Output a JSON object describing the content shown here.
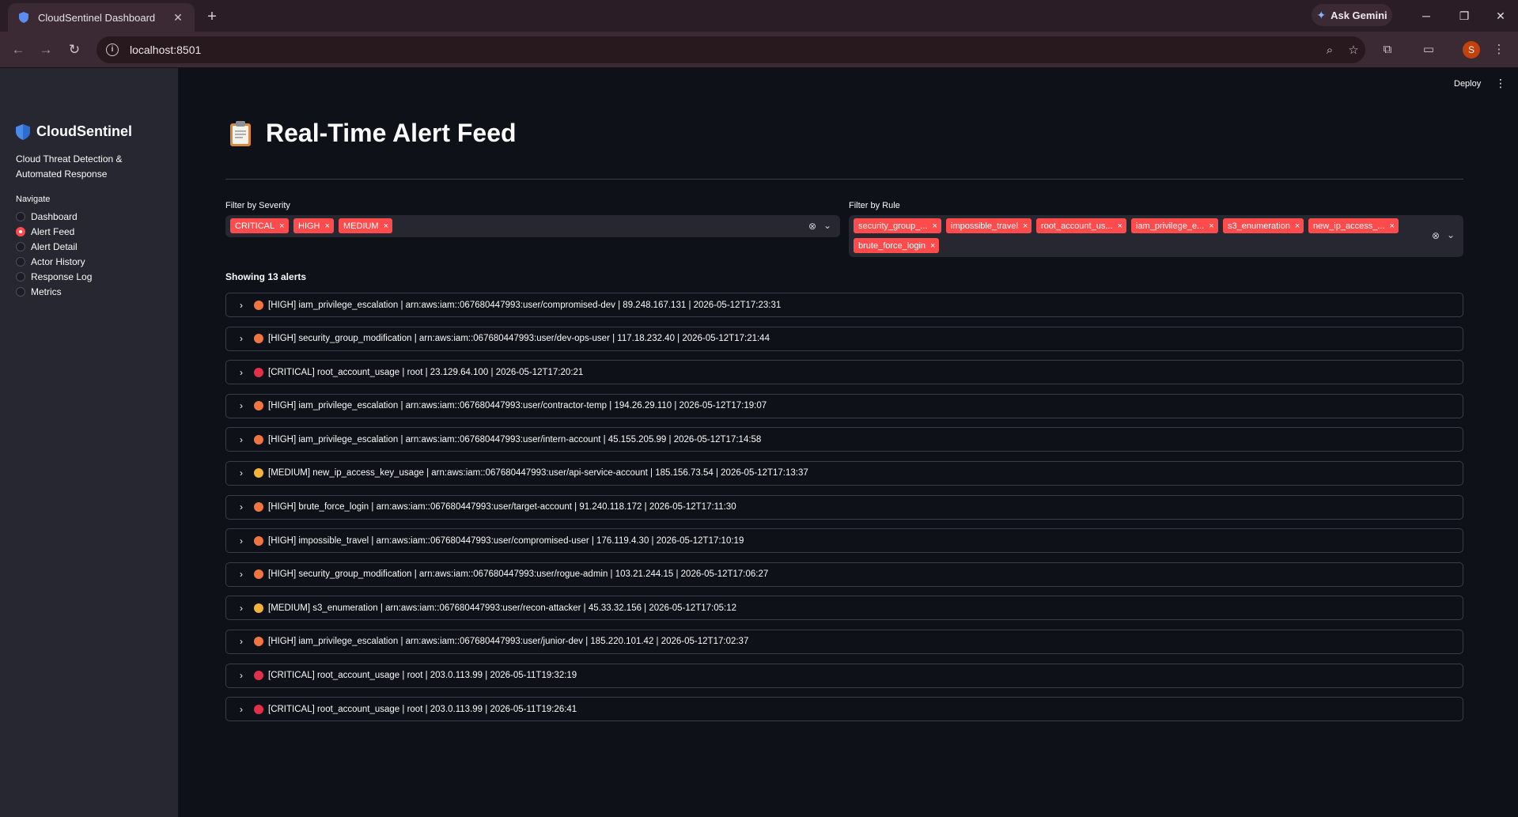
{
  "browser": {
    "tab_title": "CloudSentinel Dashboard",
    "tab_close": "✕",
    "new_tab": "+",
    "gemini_label": "Ask Gemini",
    "url": "localhost:8501",
    "profile_initial": "S"
  },
  "sidebar": {
    "brand": "CloudSentinel",
    "subtitle": "Cloud Threat Detection & Automated Response",
    "nav_label": "Navigate",
    "items": [
      {
        "label": "Dashboard",
        "selected": false
      },
      {
        "label": "Alert Feed",
        "selected": true
      },
      {
        "label": "Alert Detail",
        "selected": false
      },
      {
        "label": "Actor History",
        "selected": false
      },
      {
        "label": "Response Log",
        "selected": false
      },
      {
        "label": "Metrics",
        "selected": false
      }
    ]
  },
  "header": {
    "deploy": "Deploy",
    "menu_icon": "⋮"
  },
  "page": {
    "title": "Real-Time Alert Feed"
  },
  "filters": {
    "severity_label": "Filter by Severity",
    "severity_chips": [
      "CRITICAL",
      "HIGH",
      "MEDIUM"
    ],
    "rule_label": "Filter by Rule",
    "rule_chips": [
      "security_group_...",
      "impossible_travel",
      "root_account_us...",
      "iam_privilege_e...",
      "s3_enumeration",
      "new_ip_access_...",
      "brute_force_login"
    ],
    "chip_remove": "×"
  },
  "alert_count": "Showing 13 alerts",
  "colors": {
    "HIGH": "#f0753f",
    "CRITICAL": "#e2304a",
    "MEDIUM": "#f4b43a",
    "accent": "#ff4b4b"
  },
  "alerts": [
    {
      "severity": "HIGH",
      "text": "[HIGH] iam_privilege_escalation | arn:aws:iam::067680447993:user/compromised-dev | 89.248.167.131 | 2026-05-12T17:23:31"
    },
    {
      "severity": "HIGH",
      "text": "[HIGH] security_group_modification | arn:aws:iam::067680447993:user/dev-ops-user | 117.18.232.40 | 2026-05-12T17:21:44"
    },
    {
      "severity": "CRITICAL",
      "text": "[CRITICAL] root_account_usage | root | 23.129.64.100 | 2026-05-12T17:20:21"
    },
    {
      "severity": "HIGH",
      "text": "[HIGH] iam_privilege_escalation | arn:aws:iam::067680447993:user/contractor-temp | 194.26.29.110 | 2026-05-12T17:19:07"
    },
    {
      "severity": "HIGH",
      "text": "[HIGH] iam_privilege_escalation | arn:aws:iam::067680447993:user/intern-account | 45.155.205.99 | 2026-05-12T17:14:58"
    },
    {
      "severity": "MEDIUM",
      "text": "[MEDIUM] new_ip_access_key_usage | arn:aws:iam::067680447993:user/api-service-account | 185.156.73.54 | 2026-05-12T17:13:37"
    },
    {
      "severity": "HIGH",
      "text": "[HIGH] brute_force_login | arn:aws:iam::067680447993:user/target-account | 91.240.118.172 | 2026-05-12T17:11:30"
    },
    {
      "severity": "HIGH",
      "text": "[HIGH] impossible_travel | arn:aws:iam::067680447993:user/compromised-user | 176.119.4.30 | 2026-05-12T17:10:19"
    },
    {
      "severity": "HIGH",
      "text": "[HIGH] security_group_modification | arn:aws:iam::067680447993:user/rogue-admin | 103.21.244.15 | 2026-05-12T17:06:27"
    },
    {
      "severity": "MEDIUM",
      "text": "[MEDIUM] s3_enumeration | arn:aws:iam::067680447993:user/recon-attacker | 45.33.32.156 | 2026-05-12T17:05:12"
    },
    {
      "severity": "HIGH",
      "text": "[HIGH] iam_privilege_escalation | arn:aws:iam::067680447993:user/junior-dev | 185.220.101.42 | 2026-05-12T17:02:37"
    },
    {
      "severity": "CRITICAL",
      "text": "[CRITICAL] root_account_usage | root | 203.0.113.99 | 2026-05-11T19:32:19"
    },
    {
      "severity": "CRITICAL",
      "text": "[CRITICAL] root_account_usage | root | 203.0.113.99 | 2026-05-11T19:26:41"
    }
  ]
}
